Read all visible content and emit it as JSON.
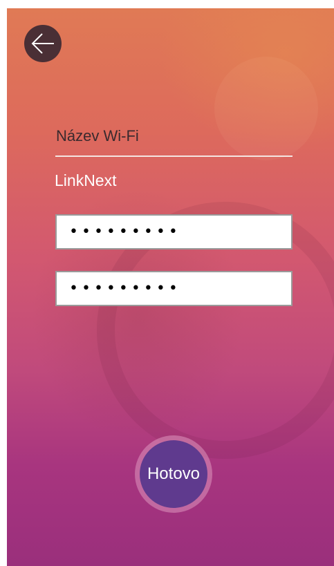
{
  "header": {
    "back_icon": "arrow-left-icon"
  },
  "wifi": {
    "name_label": "Název Wi-Fi",
    "name_value": "LinkNext"
  },
  "password": {
    "value": "•••••••••"
  },
  "password_confirm": {
    "value": "•••••••••"
  },
  "actions": {
    "done_label": "Hotovo"
  },
  "colors": {
    "back_button": "#4a2f35",
    "done_button": "#5f3a8e",
    "background_top": "#e07a55",
    "background_bottom": "#9a2f7c"
  }
}
